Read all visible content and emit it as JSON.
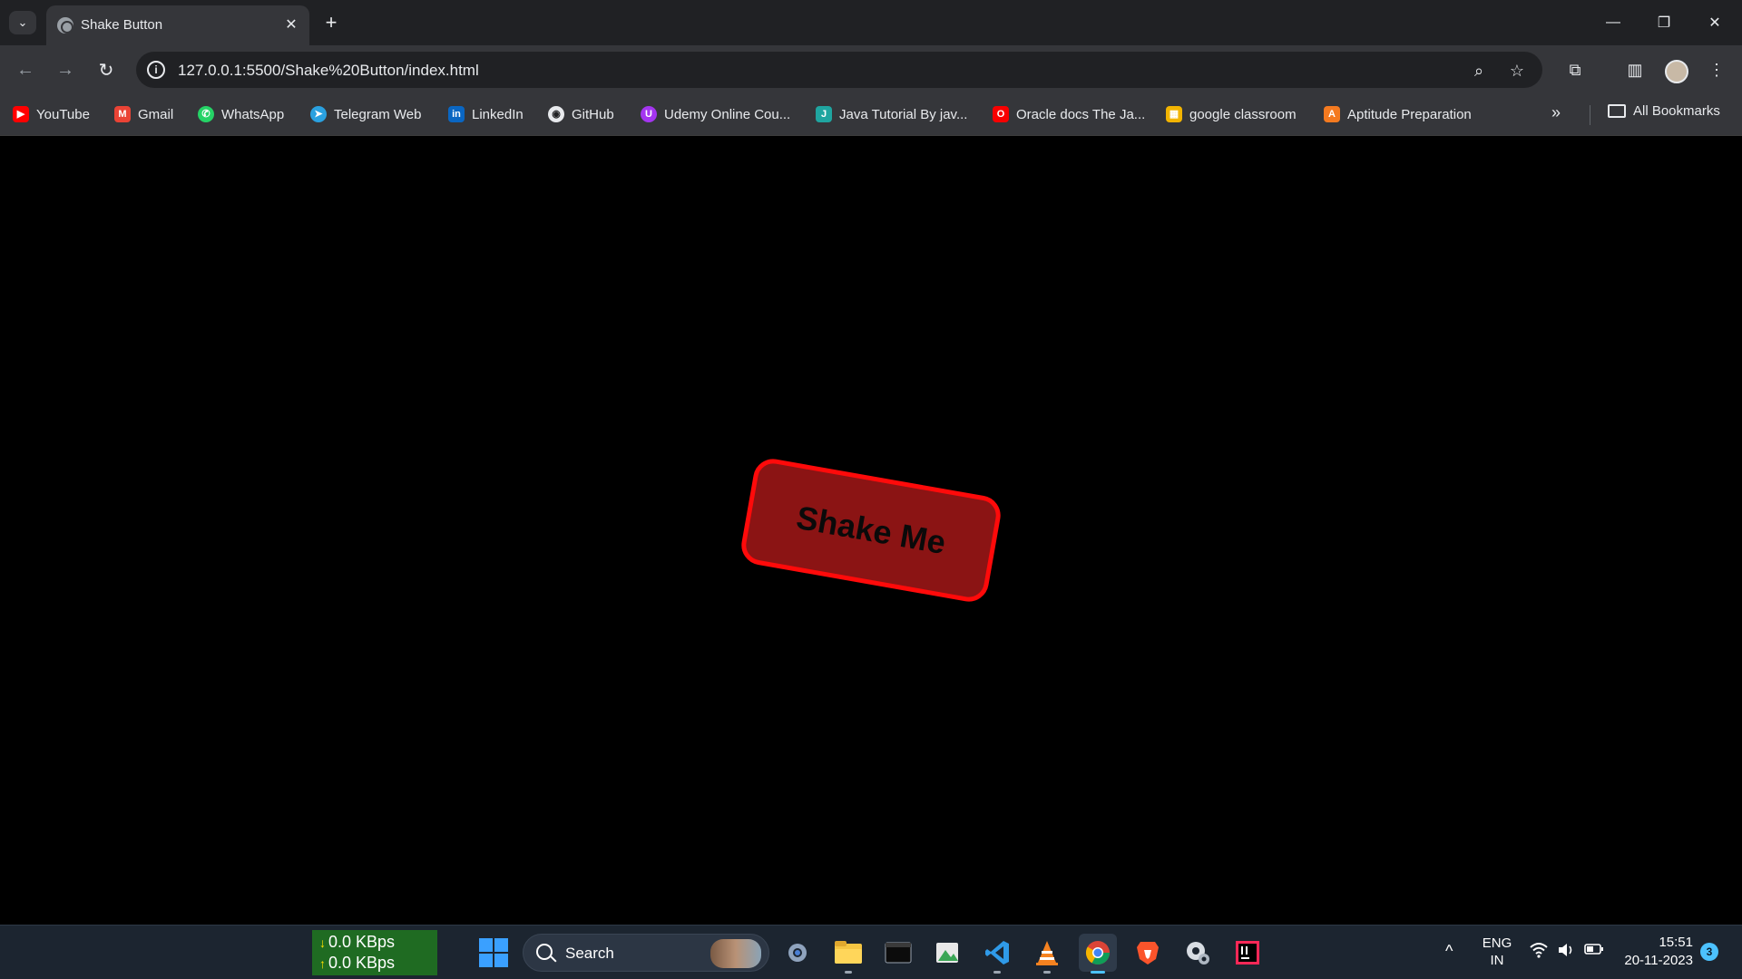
{
  "browser": {
    "tab": {
      "title": "Shake Button",
      "close_glyph": "✕"
    },
    "new_tab_glyph": "+",
    "tab_menu_glyph": "⌄",
    "window_controls": {
      "minimize": "—",
      "restore": "❐",
      "close": "✕"
    },
    "nav": {
      "back": "←",
      "forward": "→",
      "reload": "↻"
    },
    "address": {
      "url": "127.0.0.1:5500/Shake%20Button/index.html",
      "info_glyph": "i"
    },
    "toolbar_glyphs": {
      "zoom": "⌕",
      "bookmark_star": "☆",
      "extensions": "⧉",
      "side_panel": "▥",
      "menu": "⋮"
    }
  },
  "bookmarks": {
    "items": [
      {
        "label": "YouTube",
        "icon": "youtube-icon",
        "color": "#ff0000"
      },
      {
        "label": "Gmail",
        "icon": "gmail-icon",
        "color": "#ea4335"
      },
      {
        "label": "WhatsApp",
        "icon": "whatsapp-icon",
        "color": "#25d366"
      },
      {
        "label": "Telegram Web",
        "icon": "telegram-icon",
        "color": "#2aa1e0"
      },
      {
        "label": "LinkedIn",
        "icon": "linkedin-icon",
        "color": "#0a66c2"
      },
      {
        "label": "GitHub",
        "icon": "github-icon",
        "color": "#e8eaed"
      },
      {
        "label": "Udemy Online Cou...",
        "icon": "udemy-icon",
        "color": "#a435f0"
      },
      {
        "label": "Java Tutorial By jav...",
        "icon": "java-icon",
        "color": "#1fa5a0"
      },
      {
        "label": "Oracle docs The Ja...",
        "icon": "oracle-icon",
        "color": "#f80000"
      },
      {
        "label": "google classroom",
        "icon": "classroom-icon",
        "color": "#f2b400"
      },
      {
        "label": "Aptitude Preparation",
        "icon": "aptitude-icon",
        "color": "#f47a20"
      }
    ],
    "more_glyph": "»",
    "all_bookmarks": "All Bookmarks"
  },
  "page": {
    "button_label": "Shake Me",
    "colors": {
      "background": "#000000",
      "button_fill": "#8b1414",
      "button_border": "#ff0a0a"
    }
  },
  "taskbar": {
    "net_down": "0.0 KBps",
    "net_up": "0.0 KBps",
    "net_down_arrow": "↓",
    "net_up_arrow": "↑",
    "search_label": "Search",
    "tray_chevron": "^",
    "lang_top": "ENG",
    "lang_bottom": "IN",
    "time": "15:51",
    "date": "20-11-2023",
    "notification_count": "3"
  }
}
